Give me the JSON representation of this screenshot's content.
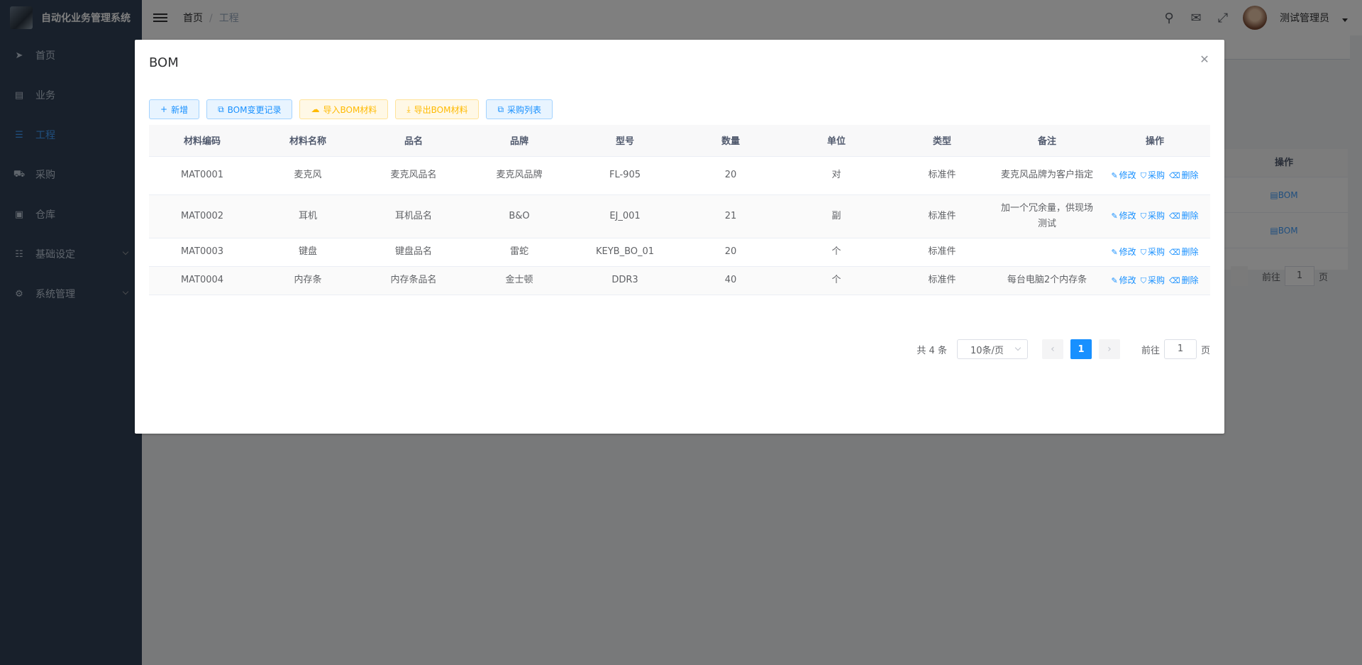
{
  "app": {
    "title": "自动化业务管理系统"
  },
  "sidebar": {
    "items": [
      {
        "label": "首页",
        "icon": "paper-plane-icon",
        "glyph": "➤"
      },
      {
        "label": "业务",
        "icon": "document-icon",
        "glyph": "▤"
      },
      {
        "label": "工程",
        "icon": "sliders-icon",
        "glyph": "☰",
        "active": true
      },
      {
        "label": "采购",
        "icon": "cart-icon",
        "glyph": "⛟"
      },
      {
        "label": "仓库",
        "icon": "box-icon",
        "glyph": "▣"
      },
      {
        "label": "基础设定",
        "icon": "settings-sliders-icon",
        "glyph": "☷",
        "expandable": true
      },
      {
        "label": "系统管理",
        "icon": "gear-icon",
        "glyph": "⚙",
        "expandable": true
      }
    ]
  },
  "header": {
    "breadcrumb": [
      "首页",
      "工程"
    ],
    "username": "测试管理员"
  },
  "background": {
    "ops_header": "操作",
    "row_action": "BOM",
    "goto": "前往",
    "page_input": "1",
    "page_suffix": "页"
  },
  "dialog": {
    "title": "BOM",
    "toolbar": [
      {
        "label": "新增",
        "style": "primary",
        "icon": "plus-icon",
        "glyph": "+"
      },
      {
        "label": "BOM变更记录",
        "style": "primary",
        "icon": "copy-icon",
        "glyph": "⧉"
      },
      {
        "label": "导入BOM材料",
        "style": "warning",
        "icon": "cloud-upload-icon",
        "glyph": "☁"
      },
      {
        "label": "导出BOM材料",
        "style": "warning",
        "icon": "download-icon",
        "glyph": "⤓"
      },
      {
        "label": "采购列表",
        "style": "primary",
        "icon": "copy-icon",
        "glyph": "⧉"
      }
    ],
    "table": {
      "columns": [
        "材料编码",
        "材料名称",
        "品名",
        "品牌",
        "型号",
        "数量",
        "单位",
        "类型",
        "备注",
        "操作"
      ],
      "rows": [
        [
          "MAT0001",
          "麦克风",
          "麦克风品名",
          "麦克风品牌",
          "FL-905",
          "20",
          "对",
          "标准件",
          "麦克风品牌为客户指定"
        ],
        [
          "MAT0002",
          "耳机",
          "耳机品名",
          "B&O",
          "EJ_001",
          "21",
          "副",
          "标准件",
          "加一个冗余量，供现场测试"
        ],
        [
          "MAT0003",
          "键盘",
          "键盘品名",
          "雷蛇",
          "KEYB_BO_01",
          "20",
          "个",
          "标准件",
          ""
        ],
        [
          "MAT0004",
          "内存条",
          "内存条品名",
          "金士顿",
          "DDR3",
          "40",
          "个",
          "标准件",
          "每台电脑2个内存条"
        ]
      ],
      "row_actions": [
        {
          "label": "修改",
          "icon": "edit-icon",
          "glyph": "✎"
        },
        {
          "label": "采购",
          "icon": "cart-icon",
          "glyph": "⛉"
        },
        {
          "label": "删除",
          "icon": "trash-icon",
          "glyph": "⌫"
        }
      ]
    },
    "pagination": {
      "total": "共 4 条",
      "page_size": "10条/页",
      "current_page": "1",
      "goto": "前往",
      "page_input": "1",
      "page_suffix": "页"
    }
  }
}
